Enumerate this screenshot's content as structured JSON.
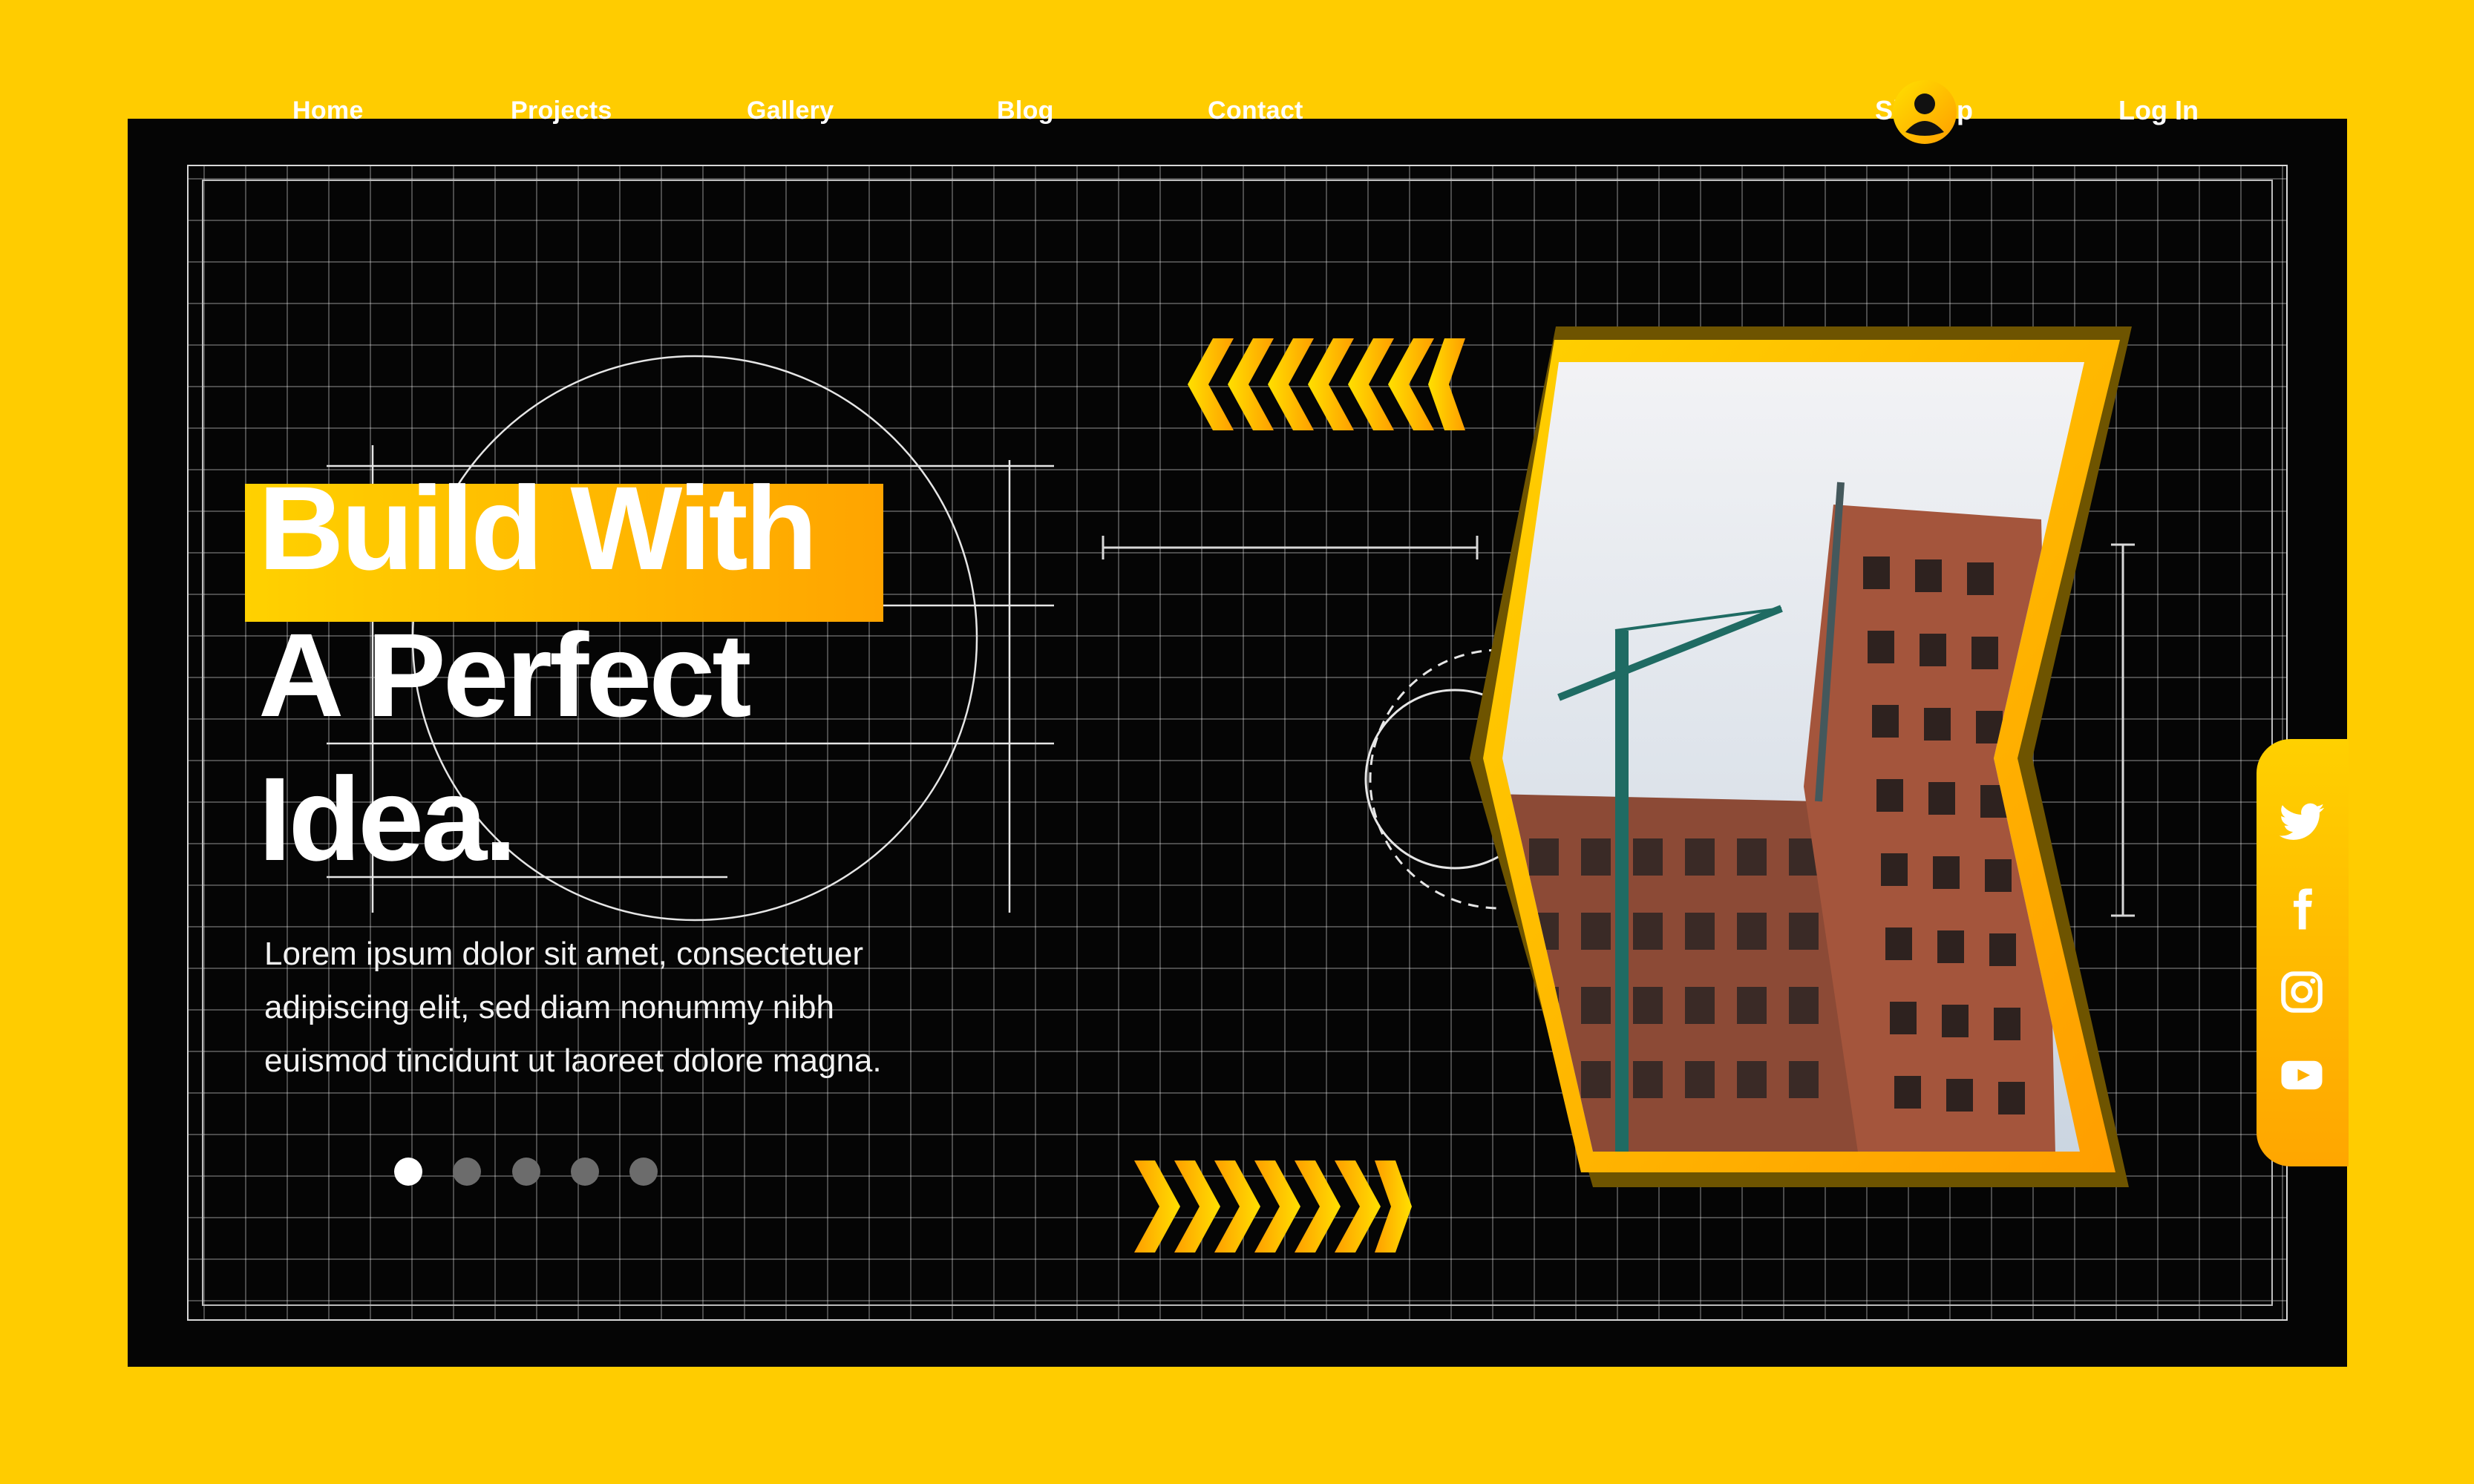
{
  "nav": {
    "items": [
      {
        "label": "Home"
      },
      {
        "label": "Projects"
      },
      {
        "label": "Gallery"
      },
      {
        "label": "Blog"
      },
      {
        "label": "Contact"
      }
    ],
    "signup_label": "Sign up",
    "login_label": "Log In",
    "user_icon": "user-icon"
  },
  "hero": {
    "title_line1": "Build With",
    "title_line2": "A Perfect",
    "title_line3": "Idea.",
    "description_line1": "Lorem ipsum dolor sit amet, consectetuer",
    "description_line2": "adipiscing elit, sed diam nonummy nibh",
    "description_line3": "euismod tincidunt ut laoreet dolore magna.",
    "slider": {
      "total": 5,
      "active_index": 0
    }
  },
  "image": {
    "description_icon": "construction-photo"
  },
  "social": {
    "icons": [
      "twitter-icon",
      "facebook-icon",
      "instagram-icon",
      "youtube-icon"
    ]
  },
  "colors": {
    "background": "#FFCC00",
    "panel": "#050505",
    "accent_start": "#FFD100",
    "accent_end": "#FFA400",
    "text": "#FFFFFF"
  }
}
